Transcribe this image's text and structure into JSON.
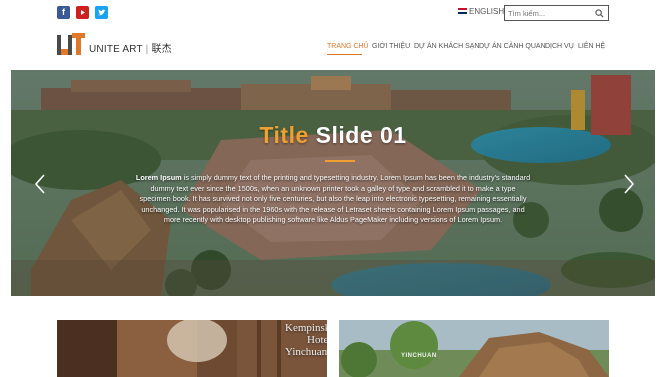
{
  "topbar": {
    "social": [
      "facebook-icon",
      "youtube-icon",
      "twitter-icon"
    ],
    "language": "ENGLISH",
    "search_placeholder": "Tìm kiếm..."
  },
  "header": {
    "logo_text": "UNITE ART",
    "logo_cjk": "联杰",
    "nav": [
      {
        "label": "TRANG CHỦ",
        "active": true
      },
      {
        "label": "GIỚI THIỆU",
        "active": false
      },
      {
        "label": "DỰ ÁN KHÁCH SẠN",
        "active": false
      },
      {
        "label": "DỰ ÁN CẢNH QUAN",
        "active": false
      },
      {
        "label": "DỊCH VỤ",
        "active": false
      },
      {
        "label": "LIÊN HỆ",
        "active": false
      }
    ]
  },
  "slider": {
    "title_word1": "Title",
    "title_word2": "Slide 01",
    "text_bold": "Lorem Ipsum",
    "text_body": " is simply dummy text of the printing and typesetting industry. Lorem Ipsum has been the industry's standard dummy text ever since the 1500s, when an unknown printer took a galley of type and scrambled it to make a type specimen book. It has survived not only five centuries, but also the leap into electronic typesetting, remaining essentially unchanged. It was popularised in the 1960s with the release of Letraset sheets containing Lorem Ipsum passages, and more recently with desktop publishing software like Aldus PageMaker including versions of Lorem Ipsum."
  },
  "thumbnails": [
    {
      "label_line1": "Kempinski",
      "label_line2": "Hotel",
      "label_line3": "Yinchuan"
    },
    {
      "label": "YINCHUAN"
    }
  ],
  "colors": {
    "accent": "#e0782a",
    "title_accent": "#f0a030",
    "facebook": "#3b5998",
    "youtube": "#cd201f",
    "twitter": "#1da1f2"
  }
}
